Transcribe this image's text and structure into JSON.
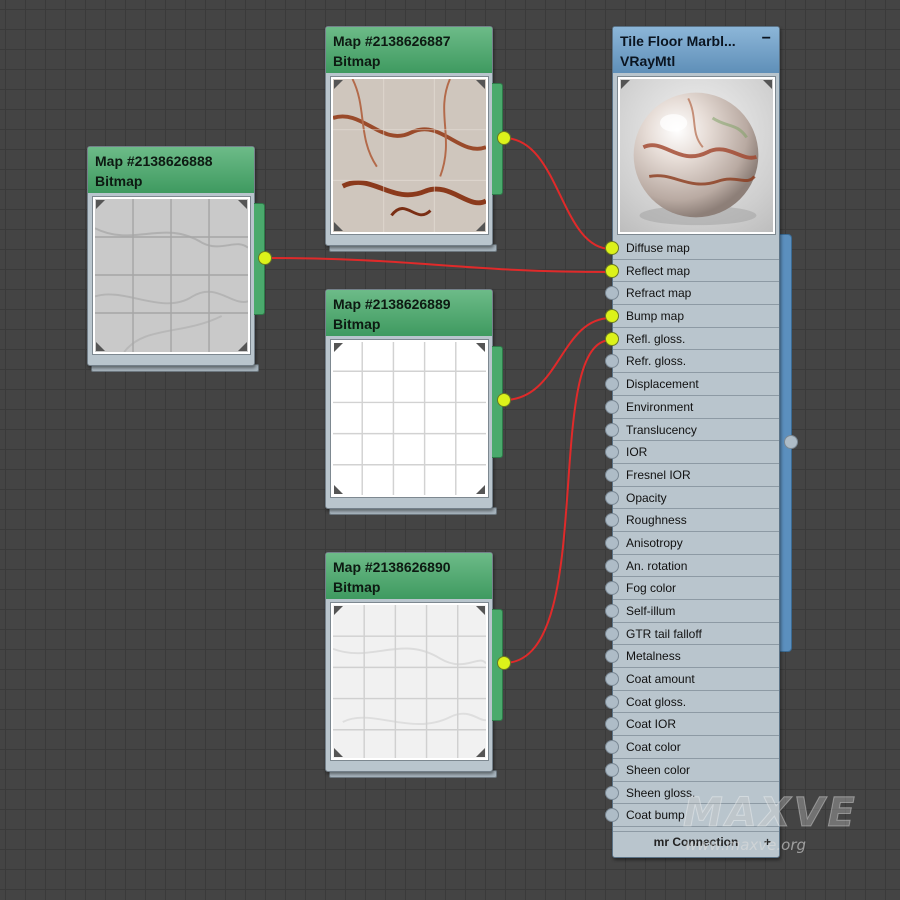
{
  "map_nodes": [
    {
      "title": "Map #2138626887",
      "type": "Bitmap",
      "texture": "veined-marble-tiles"
    },
    {
      "title": "Map #2138626888",
      "type": "Bitmap",
      "texture": "grey-marble-grid"
    },
    {
      "title": "Map #2138626889",
      "type": "Bitmap",
      "texture": "white-grid-lines"
    },
    {
      "title": "Map #2138626890",
      "type": "Bitmap",
      "texture": "white-marble-grid"
    }
  ],
  "material_node": {
    "title": "Tile Floor Marbl...",
    "type": "VRayMtl",
    "minimize_label": "−",
    "preview": "marble-sphere",
    "slots": [
      {
        "label": "Diffuse map",
        "connected": true
      },
      {
        "label": "Reflect map",
        "connected": true
      },
      {
        "label": "Refract map",
        "connected": false
      },
      {
        "label": "Bump map",
        "connected": true
      },
      {
        "label": "Refl. gloss.",
        "connected": true
      },
      {
        "label": "Refr. gloss.",
        "connected": false
      },
      {
        "label": "Displacement",
        "connected": false
      },
      {
        "label": "Environment",
        "connected": false
      },
      {
        "label": "Translucency",
        "connected": false
      },
      {
        "label": "IOR",
        "connected": false
      },
      {
        "label": "Fresnel IOR",
        "connected": false
      },
      {
        "label": "Opacity",
        "connected": false
      },
      {
        "label": "Roughness",
        "connected": false
      },
      {
        "label": "Anisotropy",
        "connected": false
      },
      {
        "label": "An. rotation",
        "connected": false
      },
      {
        "label": "Fog color",
        "connected": false
      },
      {
        "label": "Self-illum",
        "connected": false
      },
      {
        "label": "GTR tail falloff",
        "connected": false
      },
      {
        "label": "Metalness",
        "connected": false
      },
      {
        "label": "Coat amount",
        "connected": false
      },
      {
        "label": "Coat gloss.",
        "connected": false
      },
      {
        "label": "Coat IOR",
        "connected": false
      },
      {
        "label": "Coat color",
        "connected": false
      },
      {
        "label": "Sheen color",
        "connected": false
      },
      {
        "label": "Sheen gloss.",
        "connected": false
      },
      {
        "label": "Coat bump",
        "connected": false
      }
    ],
    "footer_label": "mr Connection",
    "footer_plus": "+"
  },
  "connections": [
    {
      "from": "Map #2138626887",
      "to": "Diffuse map"
    },
    {
      "from": "Map #2138626888",
      "to": "Reflect map"
    },
    {
      "from": "Map #2138626889",
      "to": "Bump map"
    },
    {
      "from": "Map #2138626890",
      "to": "Refl. gloss."
    }
  ],
  "colors": {
    "canvas": "#444444",
    "map_header": "#4fa56e",
    "material_header": "#6f9cc4",
    "wire": "#e02a2a",
    "socket_connected": "#dcf21a",
    "socket_empty": "#aebcc7"
  },
  "watermark": {
    "brand": "MAXVE",
    "site": "www.maxve.org"
  }
}
